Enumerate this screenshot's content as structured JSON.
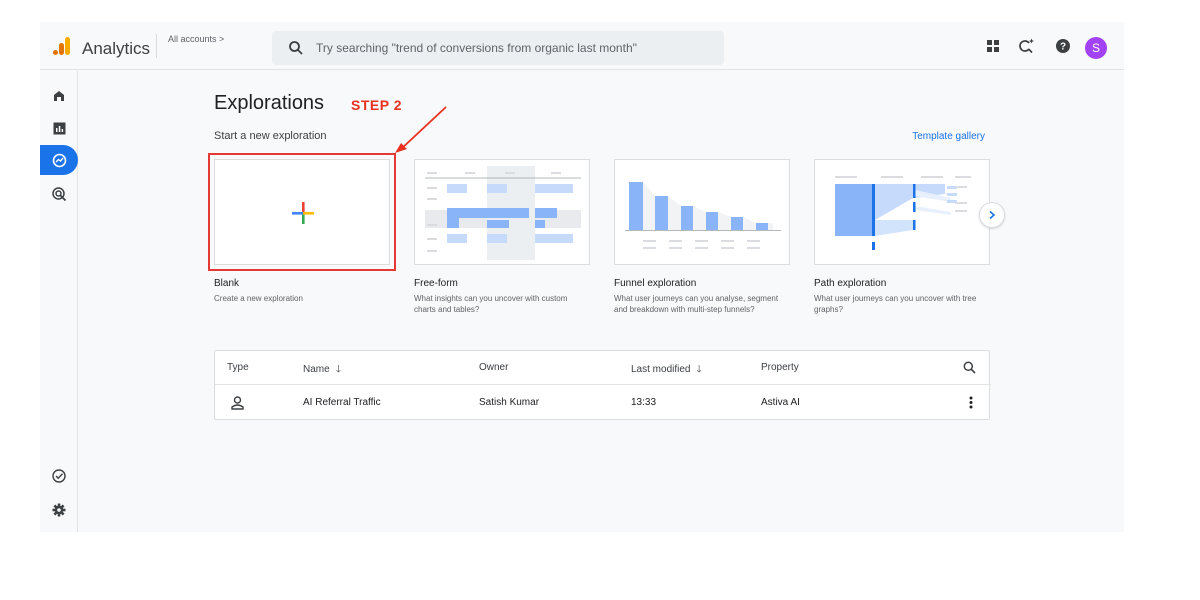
{
  "app": {
    "name": "Analytics",
    "account": "All accounts >"
  },
  "search": {
    "placeholder": "Try searching \"trend of conversions from organic last month\""
  },
  "topbar_icons": [
    "apps-icon",
    "insights-icon",
    "help-icon"
  ],
  "avatar": {
    "initial": "S",
    "color": "#a142f4"
  },
  "rail": [
    {
      "name": "home-icon",
      "active": false
    },
    {
      "name": "reports-icon",
      "active": false
    },
    {
      "name": "explore-icon",
      "active": true
    },
    {
      "name": "advertising-icon",
      "active": false
    },
    {
      "name": "admin-check-icon",
      "active": false
    },
    {
      "name": "settings-icon",
      "active": false
    }
  ],
  "page": {
    "title": "Explorations",
    "annotation": "STEP 2",
    "subtitle": "Start a new exploration",
    "template_gallery": "Template gallery"
  },
  "templates": [
    {
      "title": "Blank",
      "desc": "Create a new exploration"
    },
    {
      "title": "Free-form",
      "desc": "What insights can you uncover with custom charts and tables?"
    },
    {
      "title": "Funnel exploration",
      "desc": "What user journeys can you analyse, segment and breakdown with multi-step funnels?"
    },
    {
      "title": "Path exploration",
      "desc": "What user journeys can you uncover with tree graphs?"
    }
  ],
  "table": {
    "columns": {
      "type": "Type",
      "name": "Name",
      "owner": "Owner",
      "modified": "Last modified",
      "property": "Property"
    },
    "rows": [
      {
        "name": "AI Referral Traffic",
        "owner": "Satish Kumar",
        "modified": "13:33",
        "property": "Astiva AI"
      }
    ]
  },
  "colors": {
    "accent": "#1a73e8",
    "annotation": "#e8321f",
    "highlight_box": "#e53935"
  }
}
